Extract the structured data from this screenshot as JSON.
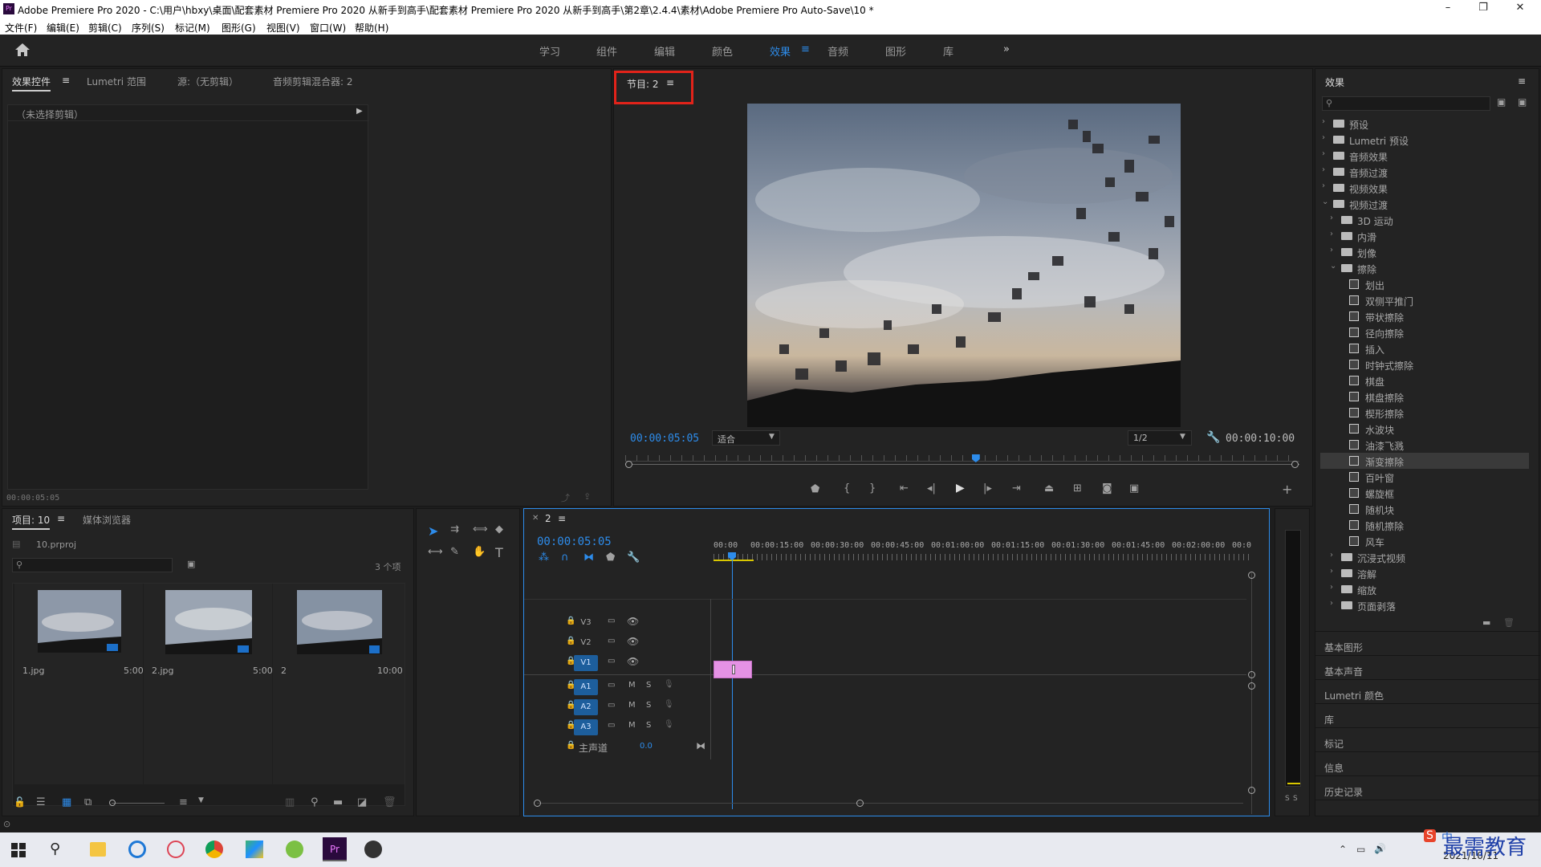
{
  "titlebar": {
    "logo": "Pr",
    "title": "Adobe Premiere Pro 2020 - C:\\用户\\hbxy\\桌面\\配套素材 Premiere Pro 2020 从新手到高手\\配套素材 Premiere Pro 2020 从新手到高手\\第2章\\2.4.4\\素材\\Adobe Premiere Pro Auto-Save\\10 *",
    "min": "–",
    "max": "❐",
    "close": "✕"
  },
  "menu": [
    "文件(F)",
    "编辑(E)",
    "剪辑(C)",
    "序列(S)",
    "标记(M)",
    "图形(G)",
    "视图(V)",
    "窗口(W)",
    "帮助(H)"
  ],
  "workspaces": {
    "items": [
      "学习",
      "组件",
      "编辑",
      "颜色",
      "效果",
      "音频",
      "图形",
      "库"
    ],
    "active": "效果",
    "more": "»"
  },
  "effect_controls": {
    "tabs": [
      "效果控件",
      "Lumetri 范围",
      "源:（无剪辑）",
      "音频剪辑混合器: 2"
    ],
    "no_clip": "（未选择剪辑）",
    "timecode": "00:00:05:05"
  },
  "program": {
    "tab": "节目: 2",
    "timecode": "00:00:05:05",
    "fit": "适合",
    "quality": "1/2",
    "duration": "00:00:10:00",
    "playhead_fraction": 0.52
  },
  "project": {
    "tabs": [
      "项目: 10",
      "媒体浏览器"
    ],
    "file": "10.prproj",
    "count": "3 个项",
    "items": [
      {
        "name": "1.jpg",
        "dur": "5:00"
      },
      {
        "name": "2.jpg",
        "dur": "5:00"
      },
      {
        "name": "2",
        "dur": "10:00"
      }
    ]
  },
  "timeline": {
    "tab": "2",
    "timecode": "00:00:05:05",
    "ruler": [
      "00:00",
      "00:00:15:00",
      "00:00:30:00",
      "00:00:45:00",
      "00:01:00:00",
      "00:01:15:00",
      "00:01:30:00",
      "00:01:45:00",
      "00:02:00:00",
      "00:0"
    ],
    "video_tracks": [
      "V3",
      "V2",
      "V1"
    ],
    "audio_tracks": [
      "A1",
      "A2",
      "A3"
    ],
    "master": "主声道",
    "master_value": "0.0",
    "mute": "M",
    "solo": "S"
  },
  "effects": {
    "title": "效果",
    "tree": [
      {
        "label": "预设",
        "type": "folder",
        "level": 0,
        "open": false
      },
      {
        "label": "Lumetri 预设",
        "type": "folder",
        "level": 0,
        "open": false
      },
      {
        "label": "音频效果",
        "type": "folder",
        "level": 0,
        "open": false
      },
      {
        "label": "音频过渡",
        "type": "folder",
        "level": 0,
        "open": false
      },
      {
        "label": "视频效果",
        "type": "folder",
        "level": 0,
        "open": false
      },
      {
        "label": "视频过渡",
        "type": "folder",
        "level": 0,
        "open": true
      },
      {
        "label": "3D 运动",
        "type": "folder",
        "level": 1,
        "open": false
      },
      {
        "label": "内滑",
        "type": "folder",
        "level": 1,
        "open": false
      },
      {
        "label": "划像",
        "type": "folder",
        "level": 1,
        "open": false
      },
      {
        "label": "擦除",
        "type": "folder",
        "level": 1,
        "open": true
      },
      {
        "label": "划出",
        "type": "effect",
        "level": 2
      },
      {
        "label": "双侧平推门",
        "type": "effect",
        "level": 2
      },
      {
        "label": "带状擦除",
        "type": "effect",
        "level": 2
      },
      {
        "label": "径向擦除",
        "type": "effect",
        "level": 2
      },
      {
        "label": "插入",
        "type": "effect",
        "level": 2
      },
      {
        "label": "时钟式擦除",
        "type": "effect",
        "level": 2
      },
      {
        "label": "棋盘",
        "type": "effect",
        "level": 2
      },
      {
        "label": "棋盘擦除",
        "type": "effect",
        "level": 2
      },
      {
        "label": "楔形擦除",
        "type": "effect",
        "level": 2
      },
      {
        "label": "水波块",
        "type": "effect",
        "level": 2
      },
      {
        "label": "油漆飞溅",
        "type": "effect",
        "level": 2
      },
      {
        "label": "渐变擦除",
        "type": "effect",
        "level": 2,
        "selected": true
      },
      {
        "label": "百叶窗",
        "type": "effect",
        "level": 2
      },
      {
        "label": "螺旋框",
        "type": "effect",
        "level": 2
      },
      {
        "label": "随机块",
        "type": "effect",
        "level": 2
      },
      {
        "label": "随机擦除",
        "type": "effect",
        "level": 2
      },
      {
        "label": "风车",
        "type": "effect",
        "level": 2
      },
      {
        "label": "沉浸式视频",
        "type": "folder",
        "level": 1,
        "open": false
      },
      {
        "label": "溶解",
        "type": "folder",
        "level": 1,
        "open": false
      },
      {
        "label": "缩放",
        "type": "folder",
        "level": 1,
        "open": false
      },
      {
        "label": "页面剥落",
        "type": "folder",
        "level": 1,
        "open": false
      }
    ],
    "sections": [
      "基本图形",
      "基本声音",
      "Lumetri 颜色",
      "库",
      "标记",
      "信息",
      "历史记录"
    ]
  },
  "taskbar": {
    "date": "2021/10/11",
    "watermark": "最需教育",
    "ime": "中"
  },
  "colors": {
    "accent": "#2d8ceb",
    "clip": "#e592e5",
    "highlight_box": "#e2231a"
  }
}
